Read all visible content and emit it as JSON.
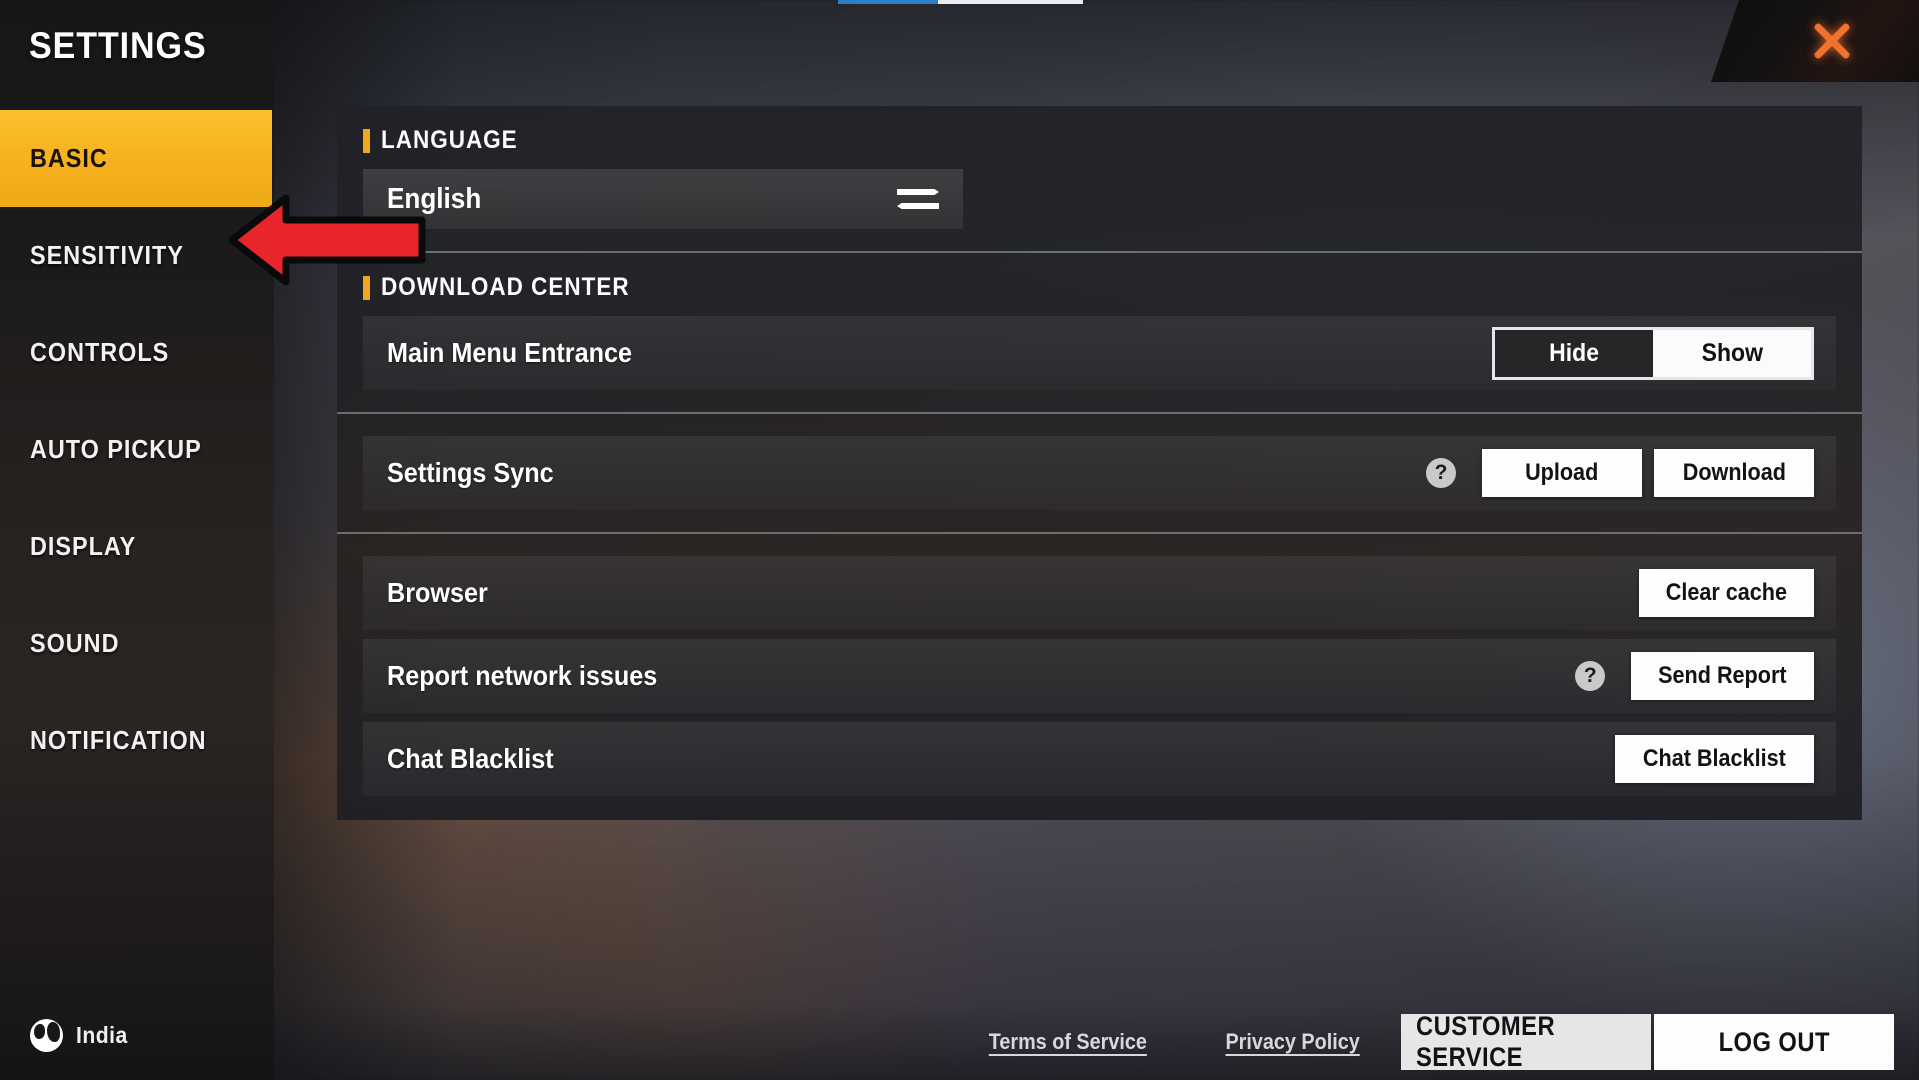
{
  "window": {
    "close_icon": "close-x-icon",
    "top_progress": {
      "visible": true
    }
  },
  "sidebar": {
    "title": "SETTINGS",
    "items": [
      {
        "label": "BASIC",
        "active": true
      },
      {
        "label": "SENSITIVITY",
        "active": false
      },
      {
        "label": "CONTROLS",
        "active": false
      },
      {
        "label": "AUTO PICKUP",
        "active": false
      },
      {
        "label": "DISPLAY",
        "active": false
      },
      {
        "label": "SOUND",
        "active": false
      },
      {
        "label": "NOTIFICATION",
        "active": false
      }
    ],
    "footer": {
      "region_icon": "globe-icon",
      "region": "India"
    }
  },
  "main": {
    "sections": [
      {
        "title": "LANGUAGE",
        "field": {
          "value": "English",
          "icon": "swap-arrows-icon"
        }
      },
      {
        "title": "DOWNLOAD CENTER",
        "rows": [
          {
            "label": "Main Menu Entrance",
            "control": "toggle",
            "options": [
              "Hide",
              "Show"
            ],
            "selected": "Show"
          }
        ]
      },
      {
        "rows": [
          {
            "label": "Settings Sync",
            "help_icon": "question-mark-icon",
            "buttons": [
              "Upload",
              "Download"
            ]
          }
        ]
      },
      {
        "rows": [
          {
            "label": "Browser",
            "buttons": [
              "Clear cache"
            ]
          },
          {
            "label": "Report network issues",
            "help_icon": "question-mark-icon",
            "buttons": [
              "Send Report"
            ]
          },
          {
            "label": "Chat Blacklist",
            "buttons": [
              "Chat Blacklist"
            ]
          }
        ]
      }
    ]
  },
  "footer": {
    "terms_label": "Terms of Service",
    "privacy_label": "Privacy Policy",
    "customer_service_label": "CUSTOMER SERVICE",
    "logout_label": "LOG OUT"
  },
  "annotation": {
    "arrow_icon": "red-left-arrow-annotation",
    "points_at": "SENSITIVITY",
    "color": "#e8252a"
  },
  "colors": {
    "accent": "#f2a81c",
    "active_nav": "#fbc02d",
    "close": "#f0722c",
    "annotation_red": "#e8252a"
  }
}
